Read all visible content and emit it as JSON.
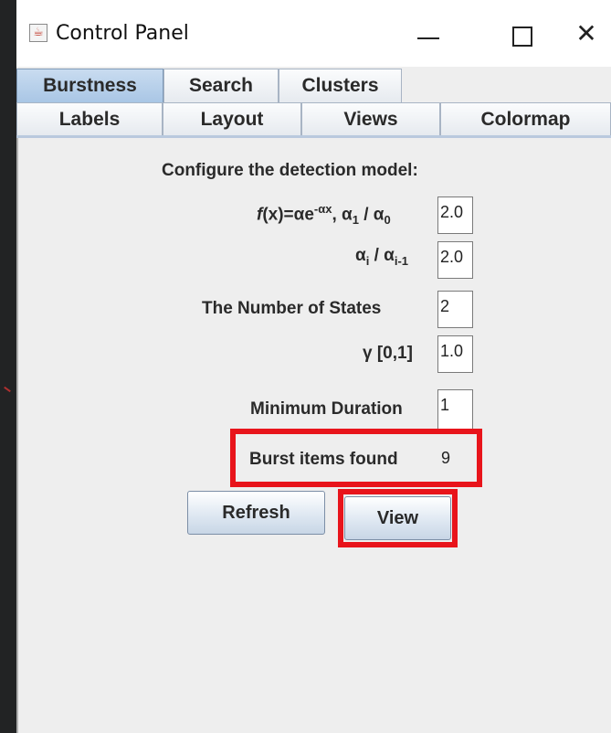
{
  "window": {
    "title": "Control Panel",
    "icon": "java-icon"
  },
  "tabs": {
    "row1": [
      {
        "label": "Burstness",
        "selected": true
      },
      {
        "label": "Search",
        "selected": false
      },
      {
        "label": "Clusters",
        "selected": false
      }
    ],
    "row2": [
      {
        "label": "Labels"
      },
      {
        "label": "Layout"
      },
      {
        "label": "Views"
      },
      {
        "label": "Colormap"
      }
    ]
  },
  "burstness": {
    "heading": "Configure the detection model:",
    "formula_label": {
      "f": "f",
      "x": "(x)=αe",
      "exp": "-αx",
      "mid": ", α",
      "sub1": "1",
      "div": " / α",
      "sub0": "0"
    },
    "formula_value": "2.0",
    "ratio_label": {
      "a": "α",
      "sub_i": "i",
      "div": " / α",
      "sub_i1": "i-1"
    },
    "ratio_value": "2.0",
    "states_label": "The Number of States",
    "states_value": "2",
    "gamma_label": "γ [0,1]",
    "gamma_value": "1.0",
    "min_duration_label": "Minimum Duration",
    "min_duration_value": "1",
    "burst_items_label": "Burst items found",
    "burst_items_value": "9",
    "refresh_label": "Refresh",
    "view_label": "View"
  },
  "highlight_color": "#e8141b"
}
